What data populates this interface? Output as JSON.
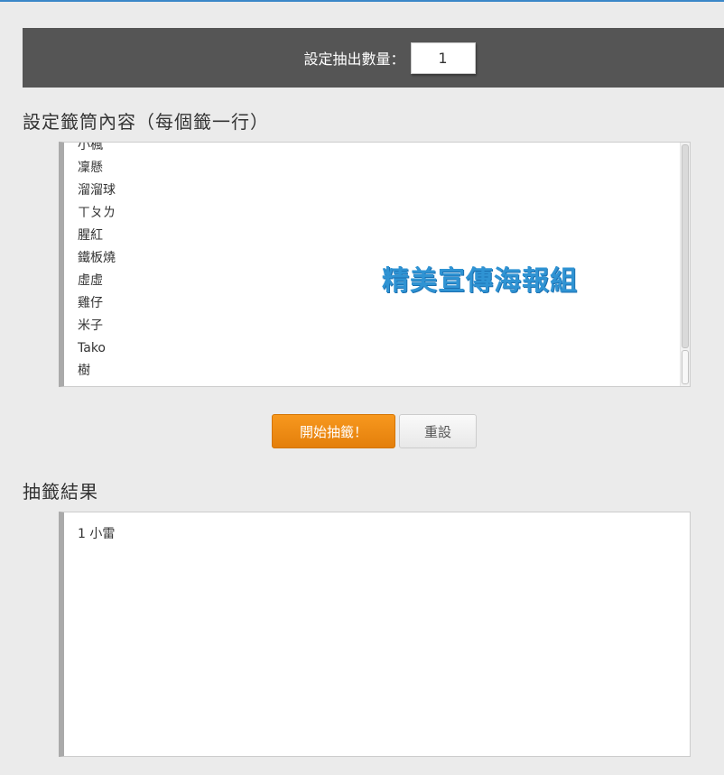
{
  "settings": {
    "count_label": "設定抽出數量：",
    "count_value": "1"
  },
  "content_section": {
    "heading": "設定籤筒內容（每個籤一行）",
    "entries": [
      "小楓",
      "凜懸",
      "溜溜球",
      "ㄒㄆㄌ",
      "腥紅",
      "鐵板燒",
      "虛虛",
      "雞仔",
      "米子",
      "Tako",
      "樹"
    ],
    "watermark": "精美宣傳海報組"
  },
  "actions": {
    "start_label": "開始抽籤！",
    "reset_label": "重設"
  },
  "result_section": {
    "heading": "抽籤結果",
    "result_text": "1 小雷"
  },
  "colors": {
    "header_bar": "#555555",
    "start_button": "#f08c16",
    "panel_border": "#aaaaaa",
    "watermark": "#2f93d3"
  }
}
